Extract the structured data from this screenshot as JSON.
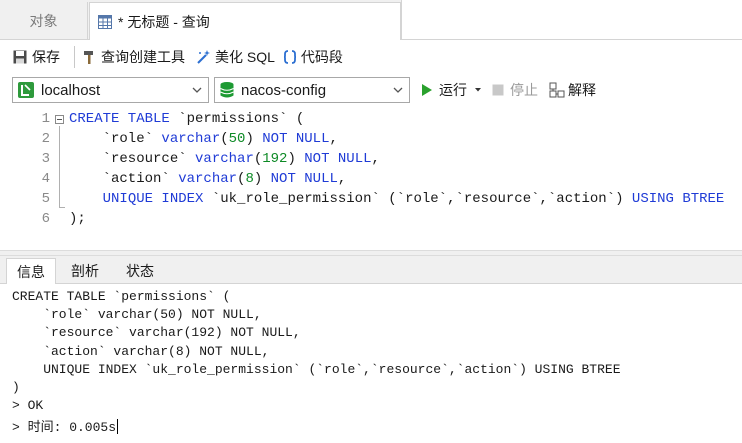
{
  "tabs": {
    "objects_label": "对象",
    "query_label": "* 无标题 - 查询"
  },
  "toolbar": {
    "save_label": "保存",
    "query_builder_label": "查询创建工具",
    "beautify_label": "美化 SQL",
    "snippet_label": "代码段"
  },
  "connection": {
    "server": "localhost",
    "database": "nacos-config",
    "run_label": "运行",
    "stop_label": "停止",
    "explain_label": "解释"
  },
  "editor": {
    "line_numbers": [
      "1",
      "2",
      "3",
      "4",
      "5",
      "6"
    ],
    "lines": [
      [
        {
          "t": "CREATE TABLE",
          "c": "kw"
        },
        {
          "t": " `permissions` (",
          "c": ""
        }
      ],
      [
        {
          "t": "    `role` ",
          "c": ""
        },
        {
          "t": "varchar",
          "c": "kw"
        },
        {
          "t": "(",
          "c": ""
        },
        {
          "t": "50",
          "c": "num"
        },
        {
          "t": ") ",
          "c": ""
        },
        {
          "t": "NOT NULL",
          "c": "kw"
        },
        {
          "t": ",",
          "c": ""
        }
      ],
      [
        {
          "t": "    `resource` ",
          "c": ""
        },
        {
          "t": "varchar",
          "c": "kw"
        },
        {
          "t": "(",
          "c": ""
        },
        {
          "t": "192",
          "c": "num"
        },
        {
          "t": ") ",
          "c": ""
        },
        {
          "t": "NOT NULL",
          "c": "kw"
        },
        {
          "t": ",",
          "c": ""
        }
      ],
      [
        {
          "t": "    `action` ",
          "c": ""
        },
        {
          "t": "varchar",
          "c": "kw"
        },
        {
          "t": "(",
          "c": ""
        },
        {
          "t": "8",
          "c": "num"
        },
        {
          "t": ") ",
          "c": ""
        },
        {
          "t": "NOT NULL",
          "c": "kw"
        },
        {
          "t": ",",
          "c": ""
        }
      ],
      [
        {
          "t": "    ",
          "c": ""
        },
        {
          "t": "UNIQUE INDEX",
          "c": "kw"
        },
        {
          "t": " `uk_role_permission` (`role`,`resource`,`action`) ",
          "c": ""
        },
        {
          "t": "USING BTREE",
          "c": "kw"
        }
      ],
      [
        {
          "t": ");",
          "c": ""
        }
      ]
    ]
  },
  "result_tabs": [
    "信息",
    "剖析",
    "状态"
  ],
  "output": {
    "lines": [
      "CREATE TABLE `permissions` (",
      "    `role` varchar(50) NOT NULL,",
      "    `resource` varchar(192) NOT NULL,",
      "    `action` varchar(8) NOT NULL,",
      "    UNIQUE INDEX `uk_role_permission` (`role`,`resource`,`action`) USING BTREE",
      ")",
      "> OK",
      "> 时间: 0.005s"
    ]
  },
  "colors": {
    "keyword": "#1f3bd6",
    "number": "#0d8a25",
    "run_green": "#2aa12e",
    "db_green": "#1d9a33"
  }
}
